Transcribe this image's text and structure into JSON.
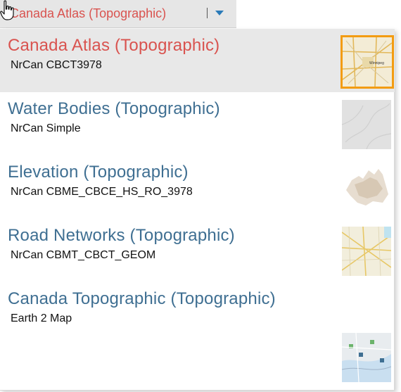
{
  "selector": {
    "current_label": "Canada Atlas (Topographic)"
  },
  "colors": {
    "accent_red": "#d9534f",
    "title_blue": "#3f6f92",
    "caret_blue": "#2a7ab8",
    "selection_orange": "#f39c12"
  },
  "basemaps": [
    {
      "title": "Canada Atlas (Topographic)",
      "subtitle": "NrCan CBCT3978",
      "selected": true
    },
    {
      "title": "Water Bodies (Topographic)",
      "subtitle": "NrCan Simple",
      "selected": false
    },
    {
      "title": "Elevation (Topographic)",
      "subtitle": "NrCan CBME_CBCE_HS_RO_3978",
      "selected": false
    },
    {
      "title": "Road Networks (Topographic)",
      "subtitle": "NrCan CBMT_CBCT_GEOM",
      "selected": false
    },
    {
      "title": "Canada Topographic (Topographic)",
      "subtitle": "Earth 2 Map",
      "selected": false
    }
  ],
  "thumbnail_map_label": "Winnipeg"
}
